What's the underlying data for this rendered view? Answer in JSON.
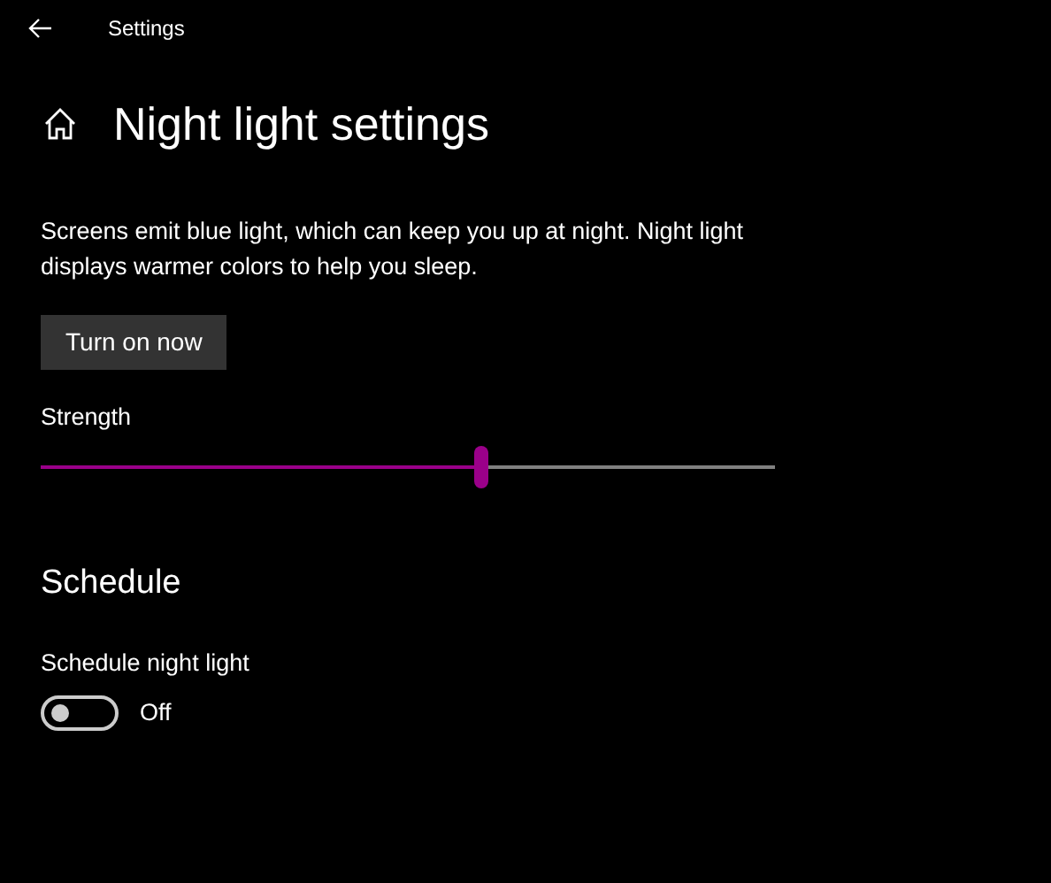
{
  "window": {
    "title": "Settings"
  },
  "page": {
    "title": "Night light settings"
  },
  "description": "Screens emit blue light, which can keep you up at night. Night light displays warmer colors to help you sleep.",
  "button": {
    "label": "Turn on now"
  },
  "strength": {
    "label": "Strength",
    "level": 0.6
  },
  "schedule": {
    "heading": "Schedule",
    "toggle_label": "Schedule night light",
    "on": false,
    "state_text": "Off"
  }
}
